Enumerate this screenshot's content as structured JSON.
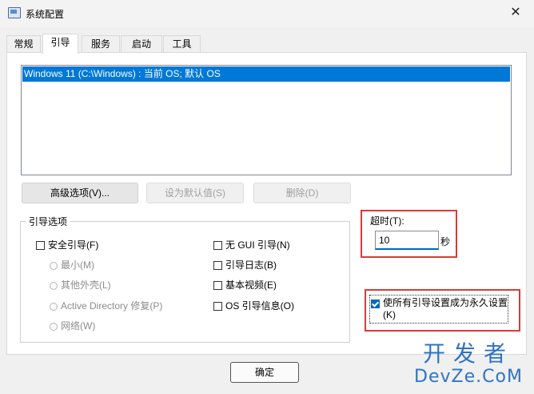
{
  "window": {
    "title": "系统配置",
    "close_glyph": "✕"
  },
  "tabs": [
    {
      "label": "常规"
    },
    {
      "label": "引导",
      "active": true
    },
    {
      "label": "服务"
    },
    {
      "label": "启动"
    },
    {
      "label": "工具"
    }
  ],
  "os_list": {
    "items": [
      "Windows 11 (C:\\Windows) : 当前 OS; 默认 OS"
    ],
    "selected_index": 0
  },
  "buttons": {
    "advanced": "高级选项(V)...",
    "set_default": "设为默认值(S)",
    "delete": "删除(D)",
    "ok": "确定"
  },
  "boot_options": {
    "title": "引导选项",
    "safe_boot": "安全引导(F)",
    "minimal": "最小(M)",
    "alternate_shell": "其他外壳(L)",
    "active_directory": "Active Directory 修复(P)",
    "network": "网络(W)",
    "no_gui": "无 GUI 引导(N)",
    "boot_log": "引导日志(B)",
    "base_video": "基本视频(E)",
    "os_boot_info": "OS 引导信息(O)"
  },
  "timeout": {
    "label": "超时(T):",
    "value": "10",
    "unit": "秒"
  },
  "make_permanent": {
    "label": "使所有引导设置成为永久设置(K)",
    "checked": true
  },
  "watermark": {
    "line1": "开发者",
    "line2": "DevZe.CoM"
  },
  "colors": {
    "selection": "#0078d7",
    "highlight_box": "#d93b3b",
    "watermark": "#2f73c3",
    "checkbox_checked": "#0067c0"
  }
}
